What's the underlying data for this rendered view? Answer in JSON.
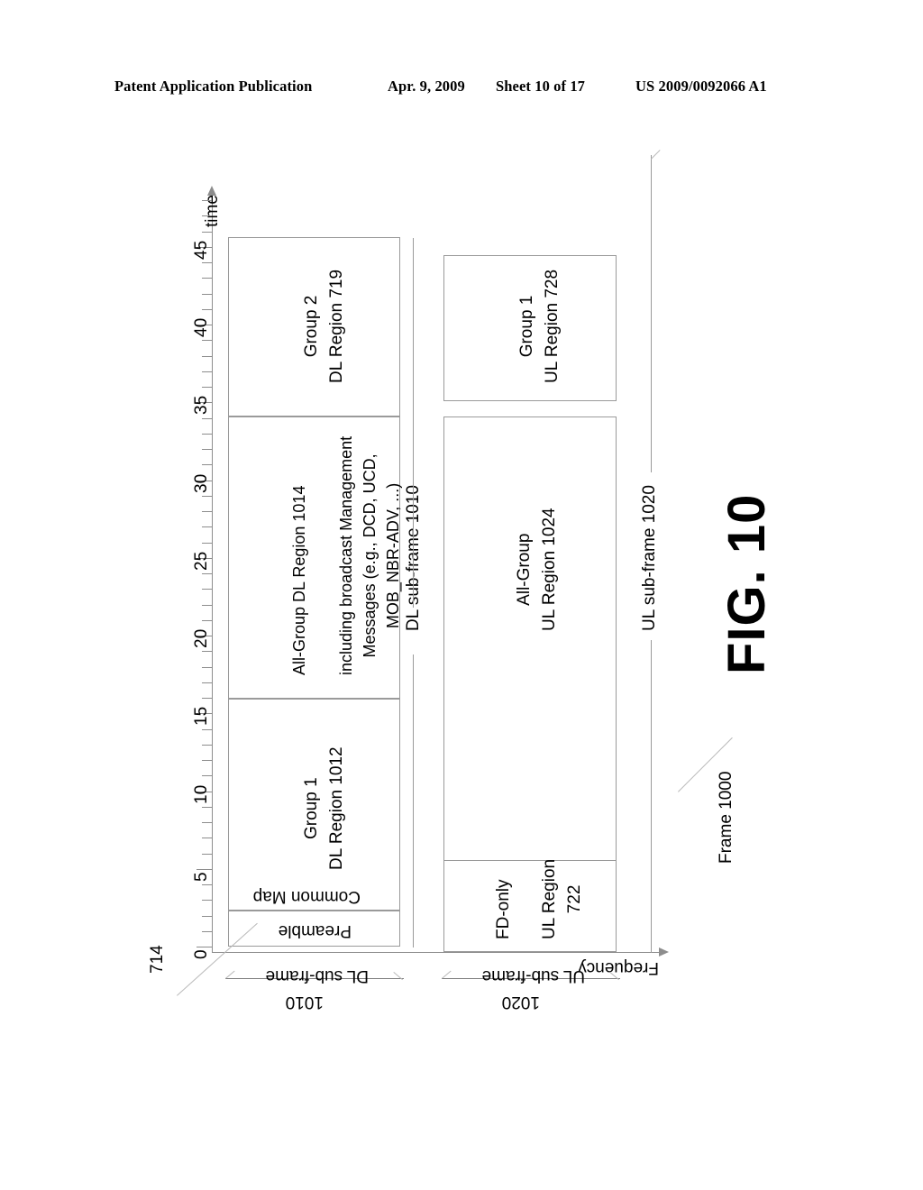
{
  "header": {
    "publication": "Patent Application Publication",
    "date": "Apr. 9, 2009",
    "sheet": "Sheet 10 of 17",
    "number": "US 2009/0092066 A1"
  },
  "figure": {
    "title": "FIG. 10",
    "frame_label": "Frame 1000",
    "ref_714": "714",
    "axes": {
      "time_label": "time",
      "frequency_label": "Frequency",
      "time_ticks": [
        "0",
        "5",
        "10",
        "15",
        "20",
        "25",
        "30",
        "35",
        "40",
        "45"
      ],
      "time_tick_values": [
        0,
        5,
        10,
        15,
        20,
        25,
        30,
        35,
        40,
        45
      ],
      "time_min": 0,
      "time_max": 48,
      "minor_tick_step": 1
    },
    "dl_subframe": {
      "bracket_label": "DL sub-frame",
      "bracket_ref": "1010",
      "side_label": "DL sub-frame 1010",
      "regions": [
        {
          "name": "preamble",
          "label": "Preamble",
          "line2": ""
        },
        {
          "name": "common-map",
          "label": "Common Map",
          "line2": ""
        },
        {
          "name": "group1-dl",
          "label": "Group 1",
          "line2": "DL Region 1012"
        },
        {
          "name": "allgroup-dl",
          "label": "All-Group DL Region 1014",
          "line2": "including broadcast Management",
          "line3": "Messages (e.g., DCD, UCD,",
          "line4": "MOB_NBR-ADV, ...)"
        },
        {
          "name": "group2-dl",
          "label": "Group 2",
          "line2": "DL Region 719"
        }
      ]
    },
    "ul_subframe": {
      "bracket_label": "UL sub-frame",
      "bracket_ref": "1020",
      "side_label": "UL sub-frame 1020",
      "regions": [
        {
          "name": "fd-only-ul",
          "label": "FD-only",
          "line2": "UL Region",
          "line3": "722"
        },
        {
          "name": "allgroup-ul",
          "label": "All-Group",
          "line2": "UL Region 1024"
        },
        {
          "name": "group1-ul",
          "label": "Group 1",
          "line2": "UL Region 728"
        }
      ]
    }
  }
}
